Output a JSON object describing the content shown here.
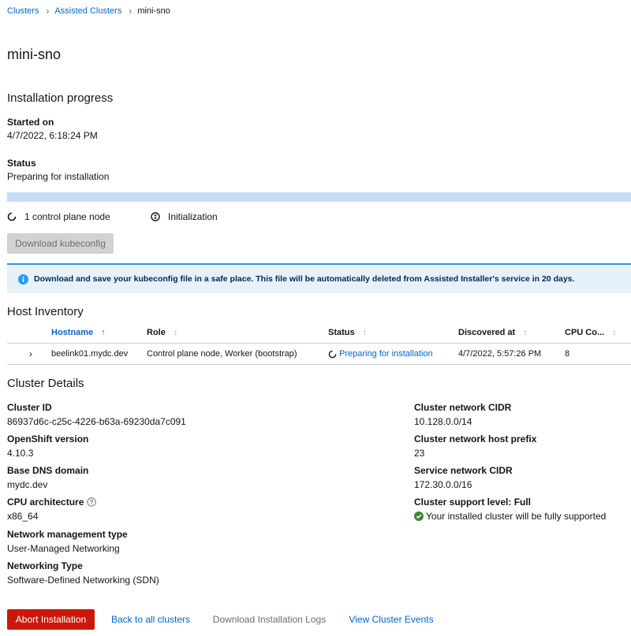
{
  "breadcrumb": {
    "items": [
      "Clusters",
      "Assisted Clusters"
    ],
    "current": "mini-sno"
  },
  "page": {
    "title": "mini-sno"
  },
  "installation_progress": {
    "title": "Installation progress",
    "started_on_label": "Started on",
    "started_on_value": "4/7/2022, 6:18:24 PM",
    "status_label": "Status",
    "status_value": "Preparing for installation",
    "progress_fraction": 0.0,
    "progress_track_color": "#c7dcf2",
    "steps": [
      {
        "label": "1 control plane node",
        "icon": "spinner-icon"
      },
      {
        "label": "Initialization",
        "icon": "pending-icon"
      }
    ],
    "download_kubeconfig_label": "Download kubeconfig"
  },
  "alert": {
    "icon": "info-circle-icon",
    "text": "Download and save your kubeconfig file in a safe place. This file will be automatically deleted from Assisted Installer's service in 20 days."
  },
  "host_inventory": {
    "title": "Host Inventory",
    "columns": [
      "Hostname",
      "Role",
      "Status",
      "Discovered at",
      "CPU Co..."
    ],
    "rows": [
      {
        "hostname": "beelink01.mydc.dev",
        "role": "Control plane node, Worker (bootstrap)",
        "status": "Preparing for installation",
        "discovered_at": "4/7/2022, 5:57:26 PM",
        "cpu_cores": "8"
      }
    ]
  },
  "cluster_details": {
    "title": "Cluster Details",
    "left": [
      {
        "label": "Cluster ID",
        "value": "86937d6c-c25c-4226-b63a-69230da7c091"
      },
      {
        "label": "OpenShift version",
        "value": "4.10.3"
      },
      {
        "label": "Base DNS domain",
        "value": "mydc.dev"
      },
      {
        "label": "CPU architecture",
        "value": "x86_64",
        "help_icon": "help-circle-icon"
      },
      {
        "label": "Network management type",
        "value": "User-Managed Networking"
      },
      {
        "label": "Networking Type",
        "value": "Software-Defined Networking (SDN)"
      }
    ],
    "right": [
      {
        "label": "Cluster network CIDR",
        "value": "10.128.0.0/14"
      },
      {
        "label": "Cluster network host prefix",
        "value": "23"
      },
      {
        "label": "Service network CIDR",
        "value": "172.30.0.0/16"
      },
      {
        "label": "Cluster support level: Full",
        "value": "Your installed cluster will be fully supported",
        "status_icon": "check-circle-icon"
      }
    ]
  },
  "footer": {
    "abort_label": "Abort Installation",
    "back_label": "Back to all clusters",
    "logs_label": "Download Installation Logs",
    "events_label": "View Cluster Events"
  },
  "colors": {
    "link": "#0066cc",
    "danger": "#c9190b",
    "success": "#3e8635",
    "info": "#2b9af3"
  }
}
